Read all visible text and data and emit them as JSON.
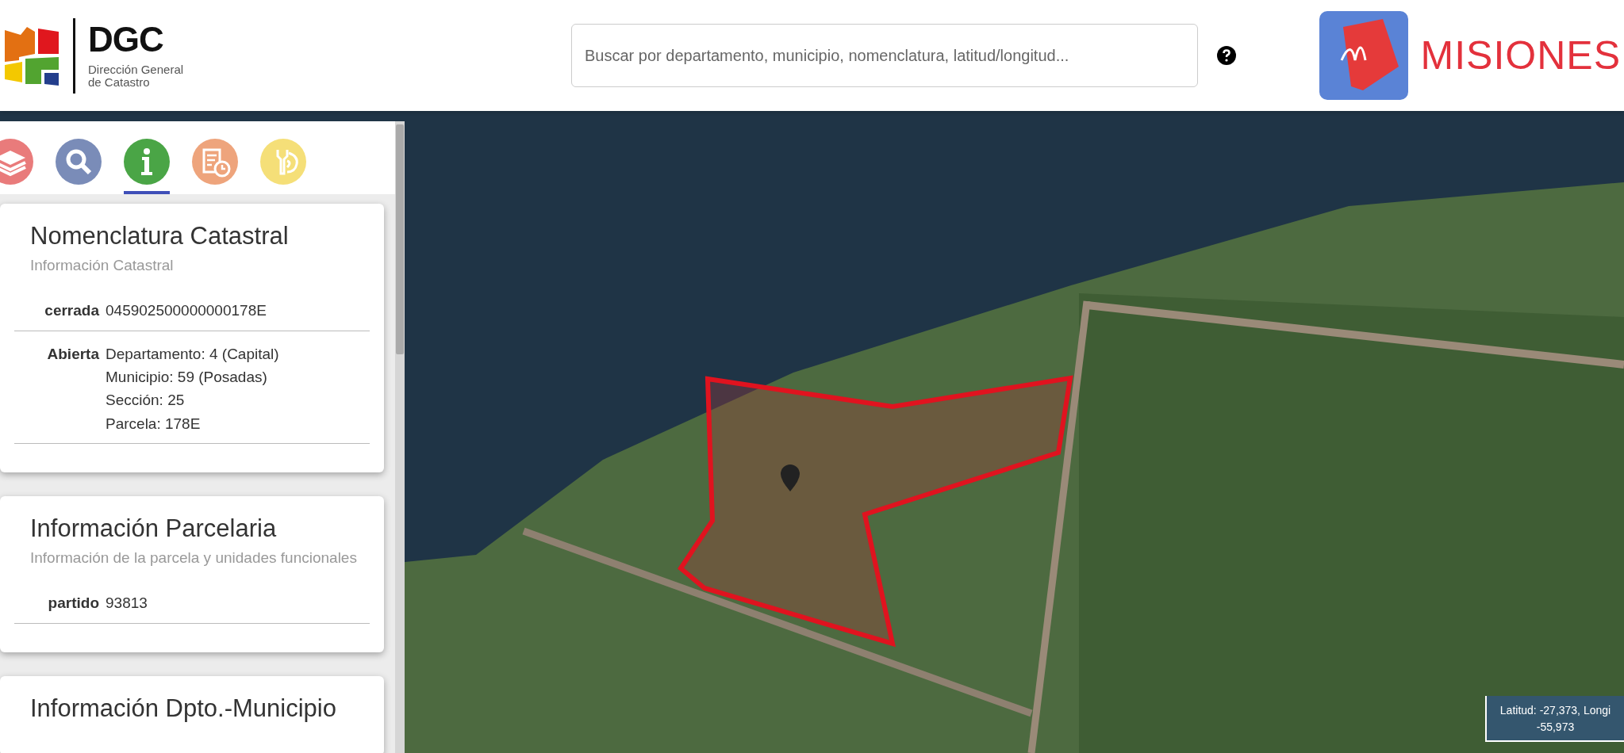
{
  "header": {
    "logo": {
      "acronym": "DGC",
      "subtitle_lines": [
        "Dirección General",
        "de Catastro"
      ]
    },
    "search": {
      "placeholder": "Buscar por departamento, municipio, nomenclatura, latitud/longitud..."
    },
    "brand": {
      "name": "MISIONES"
    }
  },
  "tabs": [
    {
      "kind": "layers",
      "color": "#e97b7b",
      "selected": false
    },
    {
      "kind": "search",
      "color": "#7a8cb8",
      "selected": false
    },
    {
      "kind": "info",
      "color": "#4aa546",
      "selected": true
    },
    {
      "kind": "report",
      "color": "#eea47c",
      "selected": false
    },
    {
      "kind": "tools",
      "color": "#f5df78",
      "selected": false
    }
  ],
  "cards": [
    {
      "title": "Nomenclatura Catastral",
      "subtitle": "Información Catastral",
      "rows": [
        {
          "label": "cerrada",
          "lines": [
            "045902500000000178E"
          ]
        },
        {
          "label": "Abierta",
          "lines": [
            "Departamento: 4 (Capital)",
            "Municipio: 59 (Posadas)",
            "Sección: 25",
            "Parcela: 178E"
          ]
        }
      ]
    },
    {
      "title": "Información Parcelaria",
      "subtitle": "Información de la parcela y unidades funcionales",
      "rows": [
        {
          "label": "partido",
          "lines": [
            "93813"
          ]
        }
      ]
    },
    {
      "title": "Información Dpto.-Municipio"
    }
  ],
  "coordinates": {
    "lines": [
      "Latitud: -27,373, Longi",
      "-55,973"
    ]
  }
}
